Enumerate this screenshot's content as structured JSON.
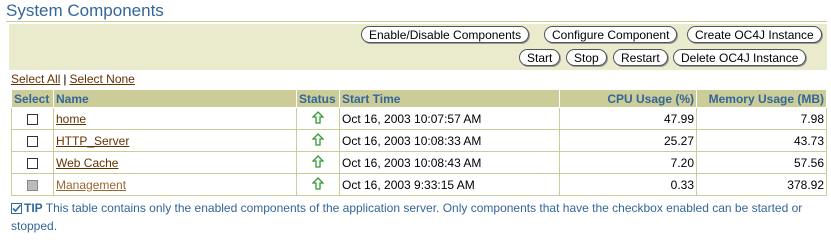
{
  "page": {
    "title": "System Components"
  },
  "buttons": {
    "enable_disable": "Enable/Disable Components",
    "configure": "Configure Component",
    "create_oc4j": "Create OC4J Instance",
    "start": "Start",
    "stop": "Stop",
    "restart": "Restart",
    "delete_oc4j": "Delete OC4J Instance"
  },
  "selection": {
    "select_all": "Select All",
    "separator": "|",
    "select_none": "Select None"
  },
  "table": {
    "headers": {
      "select": "Select",
      "name": "Name",
      "status": "Status",
      "start_time": "Start Time",
      "cpu": "CPU Usage (%)",
      "memory": "Memory Usage (MB)"
    },
    "rows": [
      {
        "name": "home",
        "status": "up",
        "start_time": "Oct 16, 2003 10:07:57 AM",
        "cpu": "47.99",
        "memory": "7.98"
      },
      {
        "name": "HTTP_Server",
        "status": "up",
        "start_time": "Oct 16, 2003 10:08:33 AM",
        "cpu": "25.27",
        "memory": "43.73"
      },
      {
        "name": "Web Cache",
        "status": "up",
        "start_time": "Oct 16, 2003 10:08:43 AM",
        "cpu": "7.20",
        "memory": "57.56"
      },
      {
        "name": "Management",
        "status": "up",
        "start_time": "Oct 16, 2003 9:33:15 AM",
        "cpu": "0.33",
        "memory": "378.92"
      }
    ]
  },
  "tip": {
    "label": "TIP",
    "text": "This table contains only the enabled components of the application server. Only components that have the checkbox enabled can be started or stopped."
  },
  "colors": {
    "header_bg": "#cccc99",
    "title": "#336699",
    "link": "#663300",
    "status_up": "#339933"
  },
  "icons": {
    "status_up": "arrow-up-icon",
    "tip": "checkmark-tip-icon"
  }
}
